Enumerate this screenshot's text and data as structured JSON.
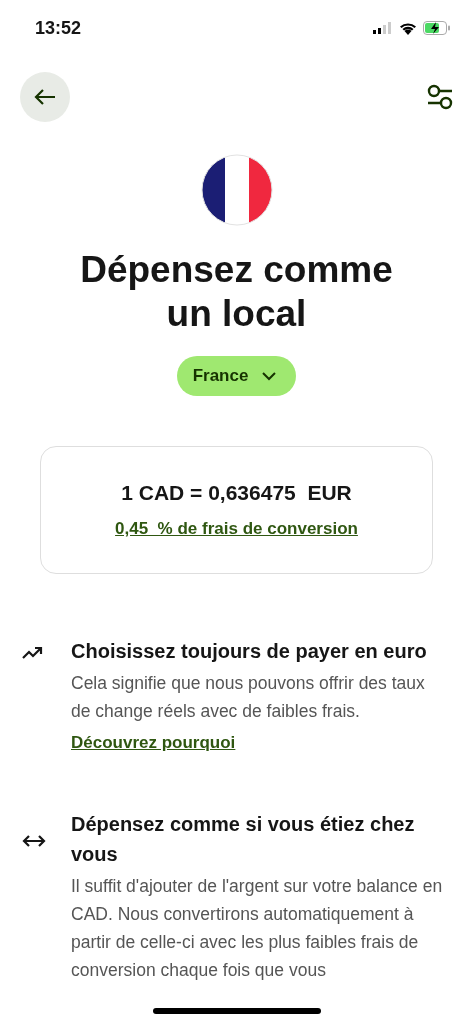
{
  "status_bar": {
    "time": "13:52"
  },
  "title": "Dépensez comme un local",
  "country_selector": {
    "label": "France"
  },
  "rate_card": {
    "rate": "1 CAD = 0,636475  EUR",
    "fee_link": "0,45  % de frais de conversion"
  },
  "features": [
    {
      "kind": "trend",
      "title": "Choisissez toujours de payer en euro",
      "body": "Cela signifie que nous pouvons offrir des taux de change réels avec de faibles frais.",
      "link": "Découvrez pourquoi"
    },
    {
      "kind": "swap",
      "title": "Dépensez comme si vous étiez chez vous",
      "body": "Il suffit d'ajouter de l'argent sur votre balance en CAD. Nous convertirons automatiquement à partir de celle-ci avec les plus faibles frais de conversion chaque fois que vous"
    }
  ]
}
